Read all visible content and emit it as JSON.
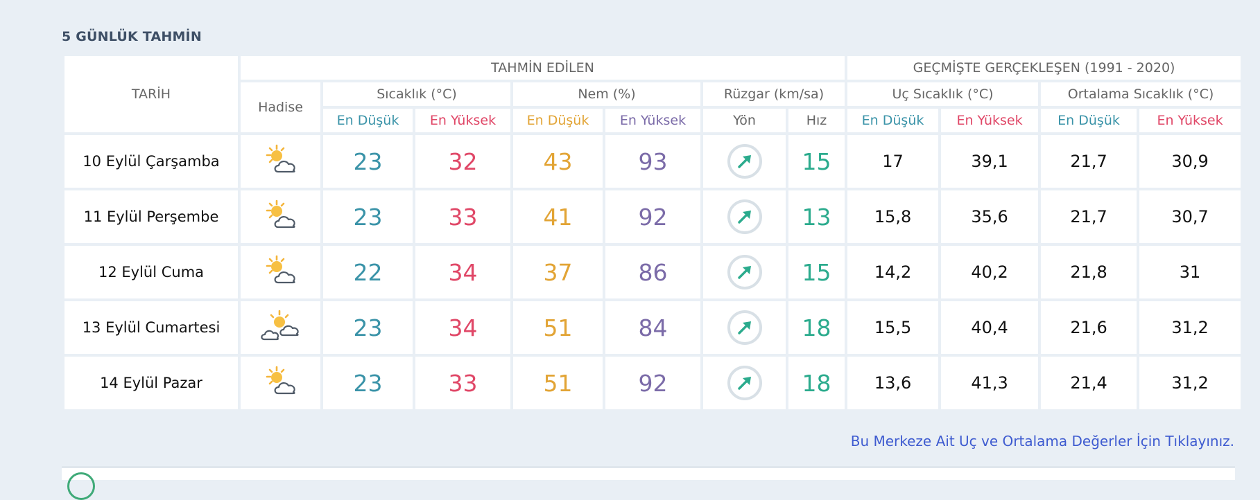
{
  "section_title": "5 GÜNLÜK TAHMİN",
  "headers": {
    "tarih": "TARİH",
    "tahmin_edilen": "TAHMİN EDİLEN",
    "gecmiste": "GEÇMİŞTE GERÇEKLEŞEN (1991 - 2020)",
    "hadise": "Hadise",
    "sicaklik": "Sıcaklık (°C)",
    "nem": "Nem (%)",
    "ruzgar": "Rüzgar (km/sa)",
    "uc_sicaklik": "Uç Sıcaklık (°C)",
    "ortalama_sicaklik": "Ortalama Sıcaklık (°C)",
    "en_dusuk": "En Düşük",
    "en_yuksek": "En Yüksek",
    "yon": "Yön",
    "hiz": "Hız"
  },
  "rows": [
    {
      "date": "10 Eylül Çarşamba",
      "icon": "partly-cloudy-icon",
      "temp_min": "23",
      "temp_max": "32",
      "hum_min": "43",
      "hum_max": "93",
      "wind_dir": "northeast-arrow-icon",
      "wind_speed": "15",
      "ext_min": "17",
      "ext_max": "39,1",
      "avg_min": "21,7",
      "avg_max": "30,9"
    },
    {
      "date": "11 Eylül Perşembe",
      "icon": "partly-cloudy-icon",
      "temp_min": "23",
      "temp_max": "33",
      "hum_min": "41",
      "hum_max": "92",
      "wind_dir": "northeast-arrow-icon",
      "wind_speed": "13",
      "ext_min": "15,8",
      "ext_max": "35,6",
      "avg_min": "21,7",
      "avg_max": "30,7"
    },
    {
      "date": "12 Eylül Cuma",
      "icon": "partly-cloudy-icon",
      "temp_min": "22",
      "temp_max": "34",
      "hum_min": "37",
      "hum_max": "86",
      "wind_dir": "northeast-arrow-icon",
      "wind_speed": "15",
      "ext_min": "14,2",
      "ext_max": "40,2",
      "avg_min": "21,8",
      "avg_max": "31"
    },
    {
      "date": "13 Eylül Cumartesi",
      "icon": "mostly-cloudy-icon",
      "temp_min": "23",
      "temp_max": "34",
      "hum_min": "51",
      "hum_max": "84",
      "wind_dir": "northeast-arrow-icon",
      "wind_speed": "18",
      "ext_min": "15,5",
      "ext_max": "40,4",
      "avg_min": "21,6",
      "avg_max": "31,2"
    },
    {
      "date": "14 Eylül Pazar",
      "icon": "partly-cloudy-icon",
      "temp_min": "23",
      "temp_max": "33",
      "hum_min": "51",
      "hum_max": "92",
      "wind_dir": "northeast-arrow-icon",
      "wind_speed": "18",
      "ext_min": "13,6",
      "ext_max": "41,3",
      "avg_min": "21,4",
      "avg_max": "31,2"
    }
  ],
  "footer_link": "Bu Merkeze Ait Uç ve Ortalama Değerler İçin Tıklayınız.",
  "colors": {
    "min": "#3a93a8",
    "max": "#e04767",
    "hum_min": "#e2a435",
    "hum_max": "#7b6ba8",
    "wind": "#2bab8d",
    "link": "#3e5bd0",
    "background": "#e9eff5"
  }
}
